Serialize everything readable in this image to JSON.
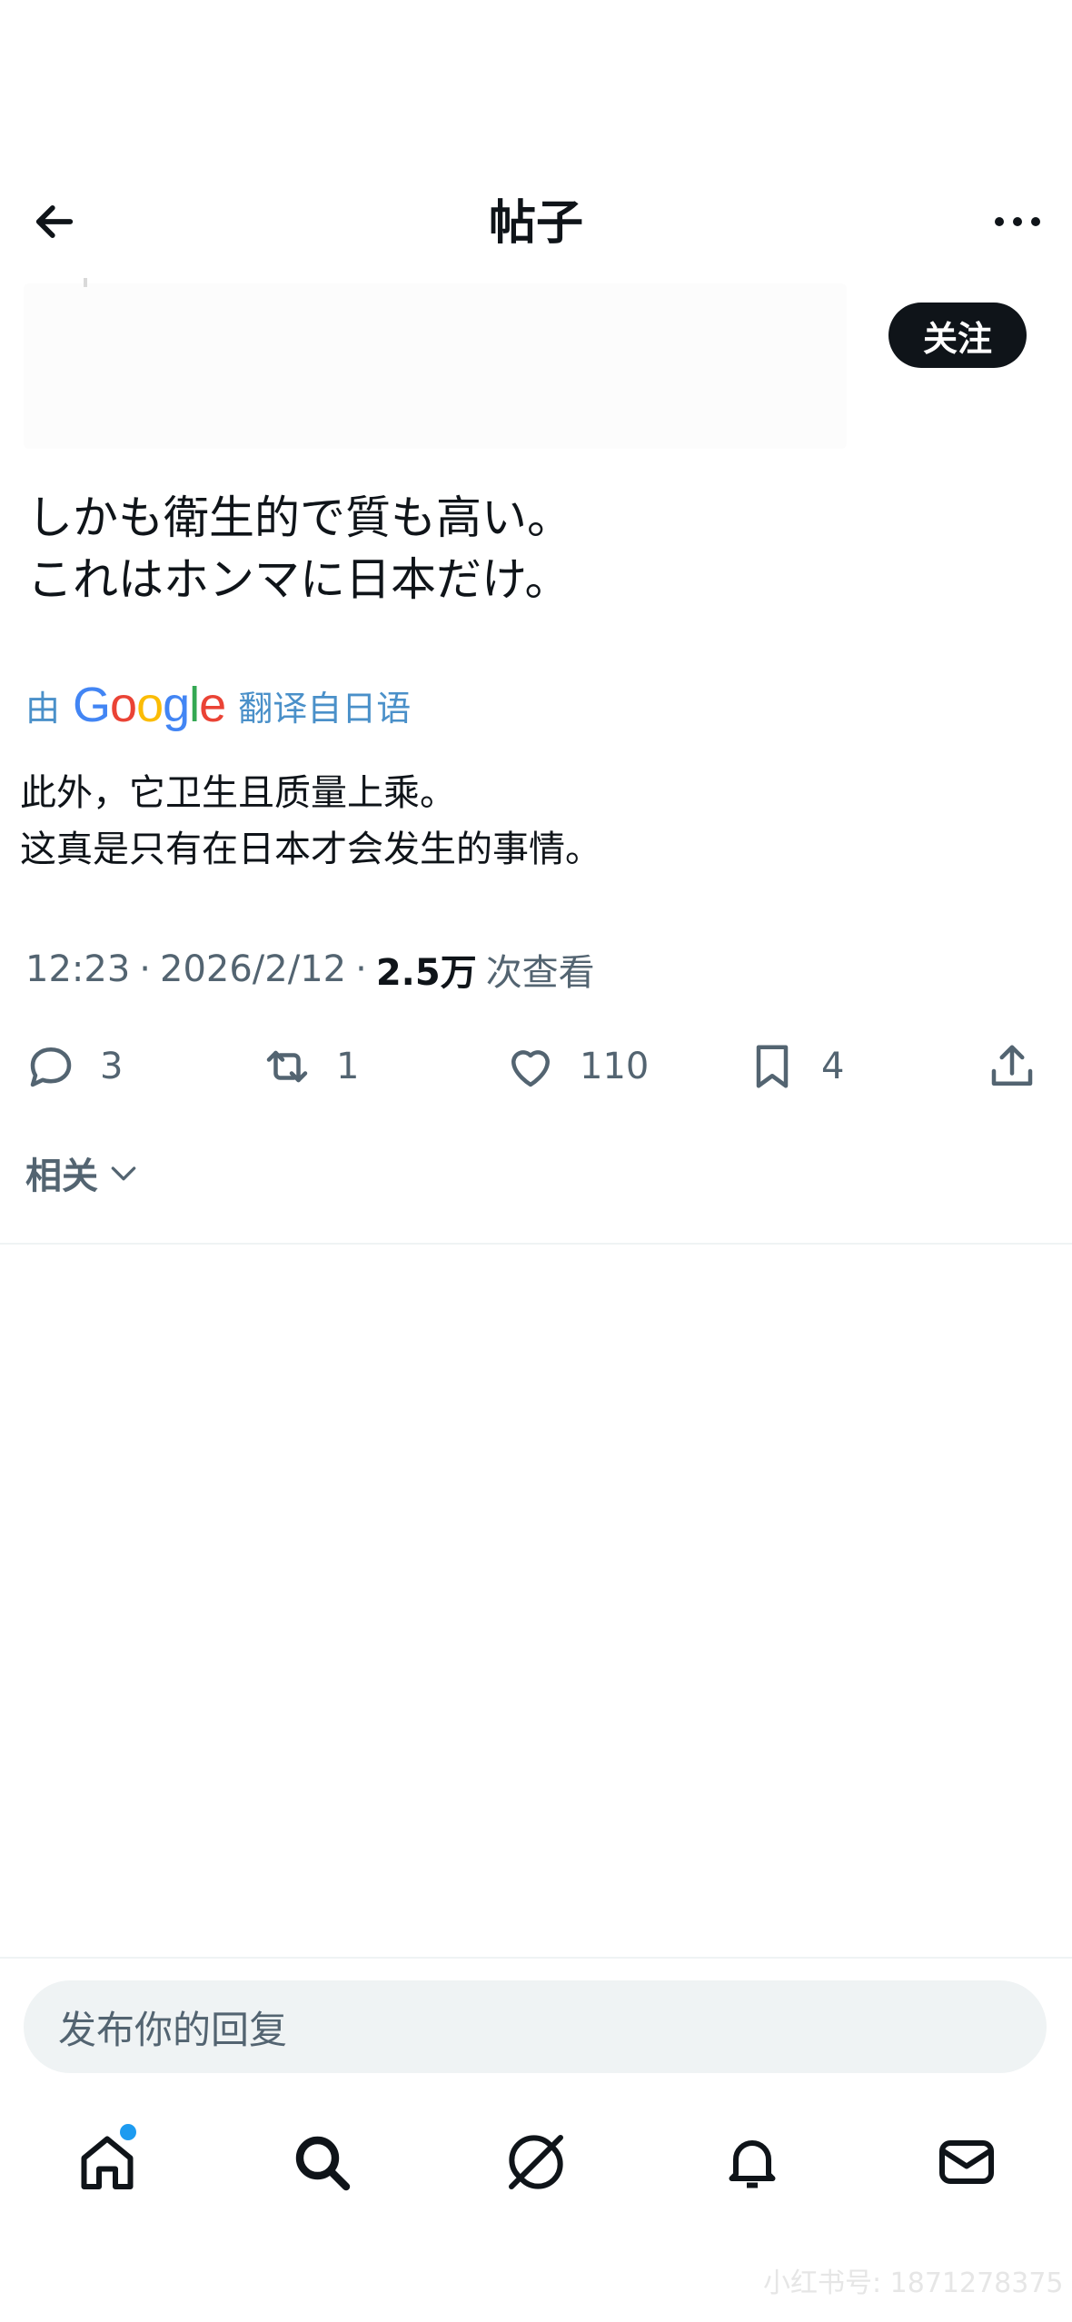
{
  "header": {
    "title": "帖子"
  },
  "follow_label": "关注",
  "post": {
    "text": "しかも衛生的で質も高い。\nこれはホンマに日本だけ。",
    "translate_prefix": "由",
    "translate_suffix": "翻译自日语",
    "translated_text": "此外，它卫生且质量上乘。\n这真是只有在日本才会发生的事情。",
    "time": "12:23",
    "date": "2026/2/12",
    "views": "2.5万",
    "views_label": "次查看"
  },
  "actions": {
    "replies": "3",
    "reposts": "1",
    "likes": "110",
    "bookmarks": "4"
  },
  "related_label": "相关",
  "reply_placeholder": "发布你的回复",
  "watermark": "小红书号: 1871278375",
  "colors": {
    "accent": "#1d9bf0",
    "text": "#0f1419",
    "muted": "#536471",
    "translate": "#4a90c9"
  },
  "icons": [
    "back-arrow-icon",
    "more-icon",
    "google-logo",
    "reply-icon",
    "repost-icon",
    "like-icon",
    "bookmark-icon",
    "share-icon",
    "chevron-down-icon",
    "home-icon",
    "search-icon",
    "grok-icon",
    "bell-icon",
    "mail-icon"
  ]
}
